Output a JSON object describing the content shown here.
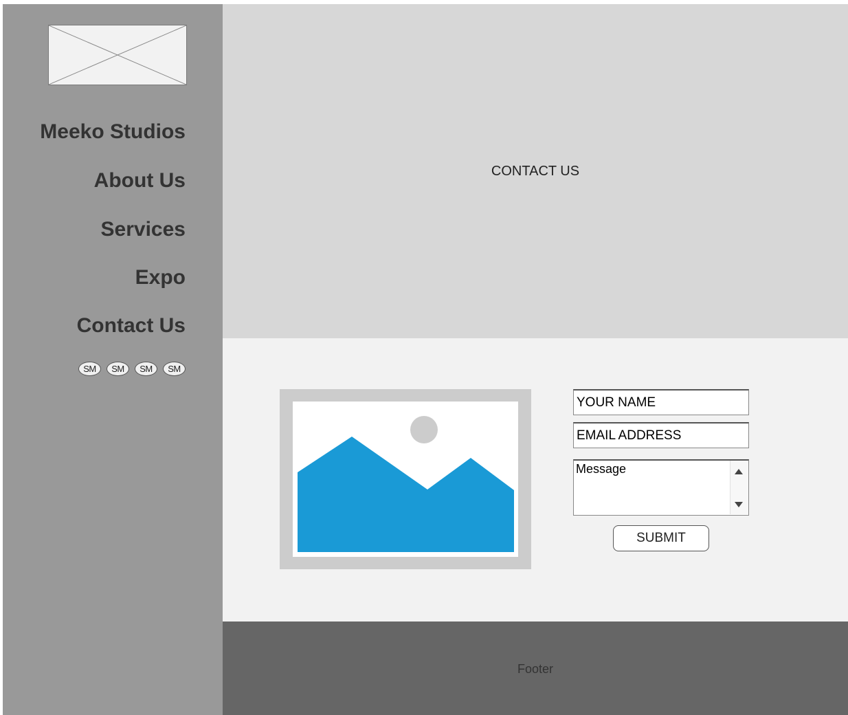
{
  "sidebar": {
    "logo_icon": "placeholder-image-icon",
    "nav": [
      {
        "label": "Meeko Studios"
      },
      {
        "label": "About Us"
      },
      {
        "label": "Services"
      },
      {
        "label": "Expo"
      },
      {
        "label": "Contact Us"
      }
    ],
    "social": [
      "SM",
      "SM",
      "SM",
      "SM"
    ]
  },
  "hero": {
    "title": "CONTACT US"
  },
  "main": {
    "image_icon": "landscape-image-icon",
    "form": {
      "name_placeholder": "YOUR NAME",
      "email_placeholder": "EMAIL ADDRESS",
      "message_placeholder": "Message",
      "submit_label": "SUBMIT"
    }
  },
  "footer": {
    "text": "Footer"
  },
  "colors": {
    "sidebar": "#999999",
    "hero": "#d7d7d7",
    "content": "#f2f2f2",
    "footer": "#666666",
    "image_blue": "#1a9ad6"
  }
}
